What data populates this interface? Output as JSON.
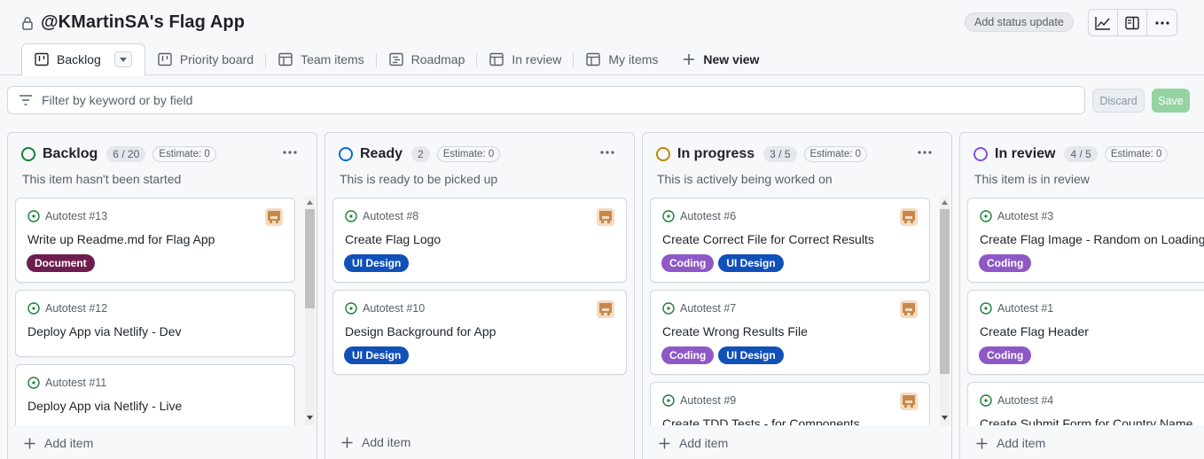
{
  "header": {
    "title": "@KMartinSA's Flag App",
    "status_button": "Add status update",
    "icons": [
      "lock-icon",
      "graph-icon",
      "sidebar-icon",
      "kebab-horizontal-icon"
    ]
  },
  "tabs": [
    {
      "label": "Backlog",
      "icon": "board-icon",
      "active": true
    },
    {
      "label": "Priority board",
      "icon": "board-icon"
    },
    {
      "label": "Team items",
      "icon": "table-icon"
    },
    {
      "label": "Roadmap",
      "icon": "roadmap-icon"
    },
    {
      "label": "In review",
      "icon": "table-icon"
    },
    {
      "label": "My items",
      "icon": "table-icon"
    }
  ],
  "new_view_label": "New view",
  "filter": {
    "placeholder": "Filter by keyword or by field",
    "value": ""
  },
  "actions": {
    "discard": "Discard",
    "save": "Save"
  },
  "colors": {
    "backlog": "#1a7f37",
    "ready": "#0969da",
    "in_progress": "#bf8700",
    "in_review": "#8250df",
    "label_document": "#6e1e4e",
    "label_ui_design": "#1150b8",
    "label_coding": "#8e58c6"
  },
  "add_item_label": "Add item",
  "columns": [
    {
      "name": "Backlog",
      "count": "6 / 20",
      "estimate": "Estimate: 0",
      "description": "This item hasn't been started",
      "cards": [
        {
          "id": "Autotest #13",
          "title": "Write up Readme.md for Flag App",
          "labels": [
            "Document"
          ]
        },
        {
          "id": "Autotest #12",
          "title": "Deploy App via Netlify - Dev",
          "labels": []
        },
        {
          "id": "Autotest #11",
          "title": "Deploy App via Netlify - Live",
          "labels": []
        }
      ]
    },
    {
      "name": "Ready",
      "count": "2",
      "estimate": "Estimate: 0",
      "description": "This is ready to be picked up",
      "cards": [
        {
          "id": "Autotest #8",
          "title": "Create Flag Logo",
          "labels": [
            "UI Design"
          ]
        },
        {
          "id": "Autotest #10",
          "title": "Design Background for App",
          "labels": [
            "UI Design"
          ]
        }
      ]
    },
    {
      "name": "In progress",
      "count": "3 / 5",
      "estimate": "Estimate: 0",
      "description": "This is actively being worked on",
      "cards": [
        {
          "id": "Autotest #6",
          "title": "Create Correct File for Correct Results",
          "labels": [
            "Coding",
            "UI Design"
          ]
        },
        {
          "id": "Autotest #7",
          "title": "Create Wrong Results File",
          "labels": [
            "Coding",
            "UI Design"
          ]
        },
        {
          "id": "Autotest #9",
          "title": "Create TDD Tests - for Components",
          "labels": []
        }
      ]
    },
    {
      "name": "In review",
      "count": "4 / 5",
      "estimate": "Estimate: 0",
      "description": "This item is in review",
      "cards": [
        {
          "id": "Autotest #3",
          "title": "Create Flag Image - Random on Loading",
          "labels": [
            "Coding"
          ]
        },
        {
          "id": "Autotest #1",
          "title": "Create Flag Header",
          "labels": [
            "Coding"
          ]
        },
        {
          "id": "Autotest #4",
          "title": "Create Submit Form for Country Name",
          "labels": []
        }
      ]
    }
  ]
}
